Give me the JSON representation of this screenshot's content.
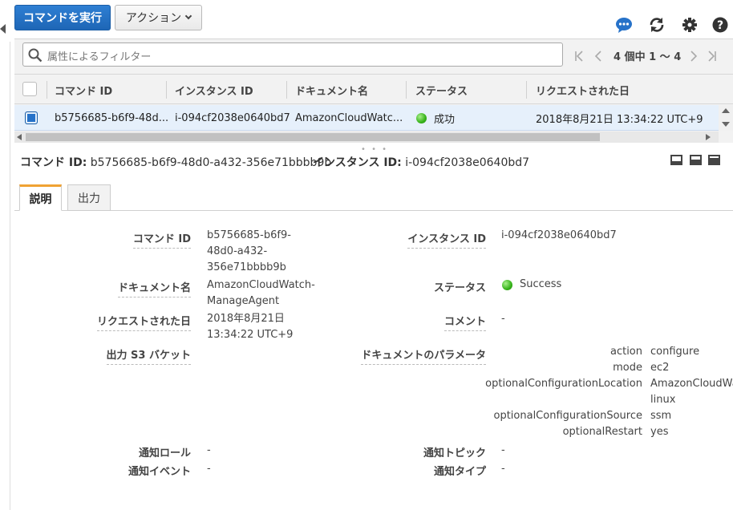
{
  "toolbar": {
    "run_command": "コマンドを実行",
    "actions": "アクション",
    "icons": [
      "chat-icon",
      "refresh-icon",
      "gear-icon",
      "help-icon"
    ]
  },
  "filter": {
    "placeholder": "属性によるフィルター"
  },
  "pagination": {
    "text": "4 個中 1 ～ 4"
  },
  "table": {
    "headers": [
      "コマンド ID",
      "インスタンス ID",
      "ドキュメント名",
      "ステータス",
      "リクエストされた日"
    ],
    "rows": [
      {
        "command_id": "b5756685-b6f9-48d...",
        "instance_id": "i-094cf2038e0640bd7",
        "document": "AmazonCloudWatc...",
        "status": "成功",
        "requested": "2018年8月21日 13:34:22 UTC+9"
      }
    ]
  },
  "detail_header": {
    "command_label": "コマンド ID:",
    "command_value": "b5756685-b6f9-48d0-a432-356e71bbbb9b",
    "instance_label": "インスタンス ID:",
    "instance_value": "i-094cf2038e0640bd7"
  },
  "tabs": [
    "説明",
    "出力"
  ],
  "details": {
    "command_id_label": "コマンド ID",
    "command_id_lines": [
      "b5756685-b6f9-",
      "48d0-a432-",
      "356e71bbbb9b"
    ],
    "document_label": "ドキュメント名",
    "document_lines": [
      "AmazonCloudWatch-",
      "ManageAgent"
    ],
    "requested_label": "リクエストされた日",
    "requested_lines": [
      "2018年8月21日",
      "13:34:22 UTC+9"
    ],
    "s3_label": "出力 S3 バケット",
    "instance_id_label": "インスタンス ID",
    "instance_id_value": "i-094cf2038e0640bd7",
    "status_label": "ステータス",
    "status_value": "Success",
    "comment_label": "コメント",
    "comment_value": "-",
    "params_label": "ドキュメントのパラメータ",
    "params": [
      {
        "key": "action",
        "value": "configure"
      },
      {
        "key": "mode",
        "value": "ec2"
      },
      {
        "key": "optionalConfigurationLocation",
        "value": "AmazonCloudWa"
      },
      {
        "key": "",
        "value": "linux"
      },
      {
        "key": "optionalConfigurationSource",
        "value": "ssm"
      },
      {
        "key": "optionalRestart",
        "value": "yes"
      }
    ],
    "notify_role_label": "通知ロール",
    "notify_role_value": "-",
    "notify_event_label": "通知イベント",
    "notify_event_value": "-",
    "notify_topic_label": "通知トピック",
    "notify_topic_value": "-",
    "notify_type_label": "通知タイプ",
    "notify_type_value": "-"
  },
  "colors": {
    "primary": "#2672c9",
    "accent_tab": "#f0a233",
    "success": "#36b219",
    "selected_row": "#e6f0fb"
  }
}
